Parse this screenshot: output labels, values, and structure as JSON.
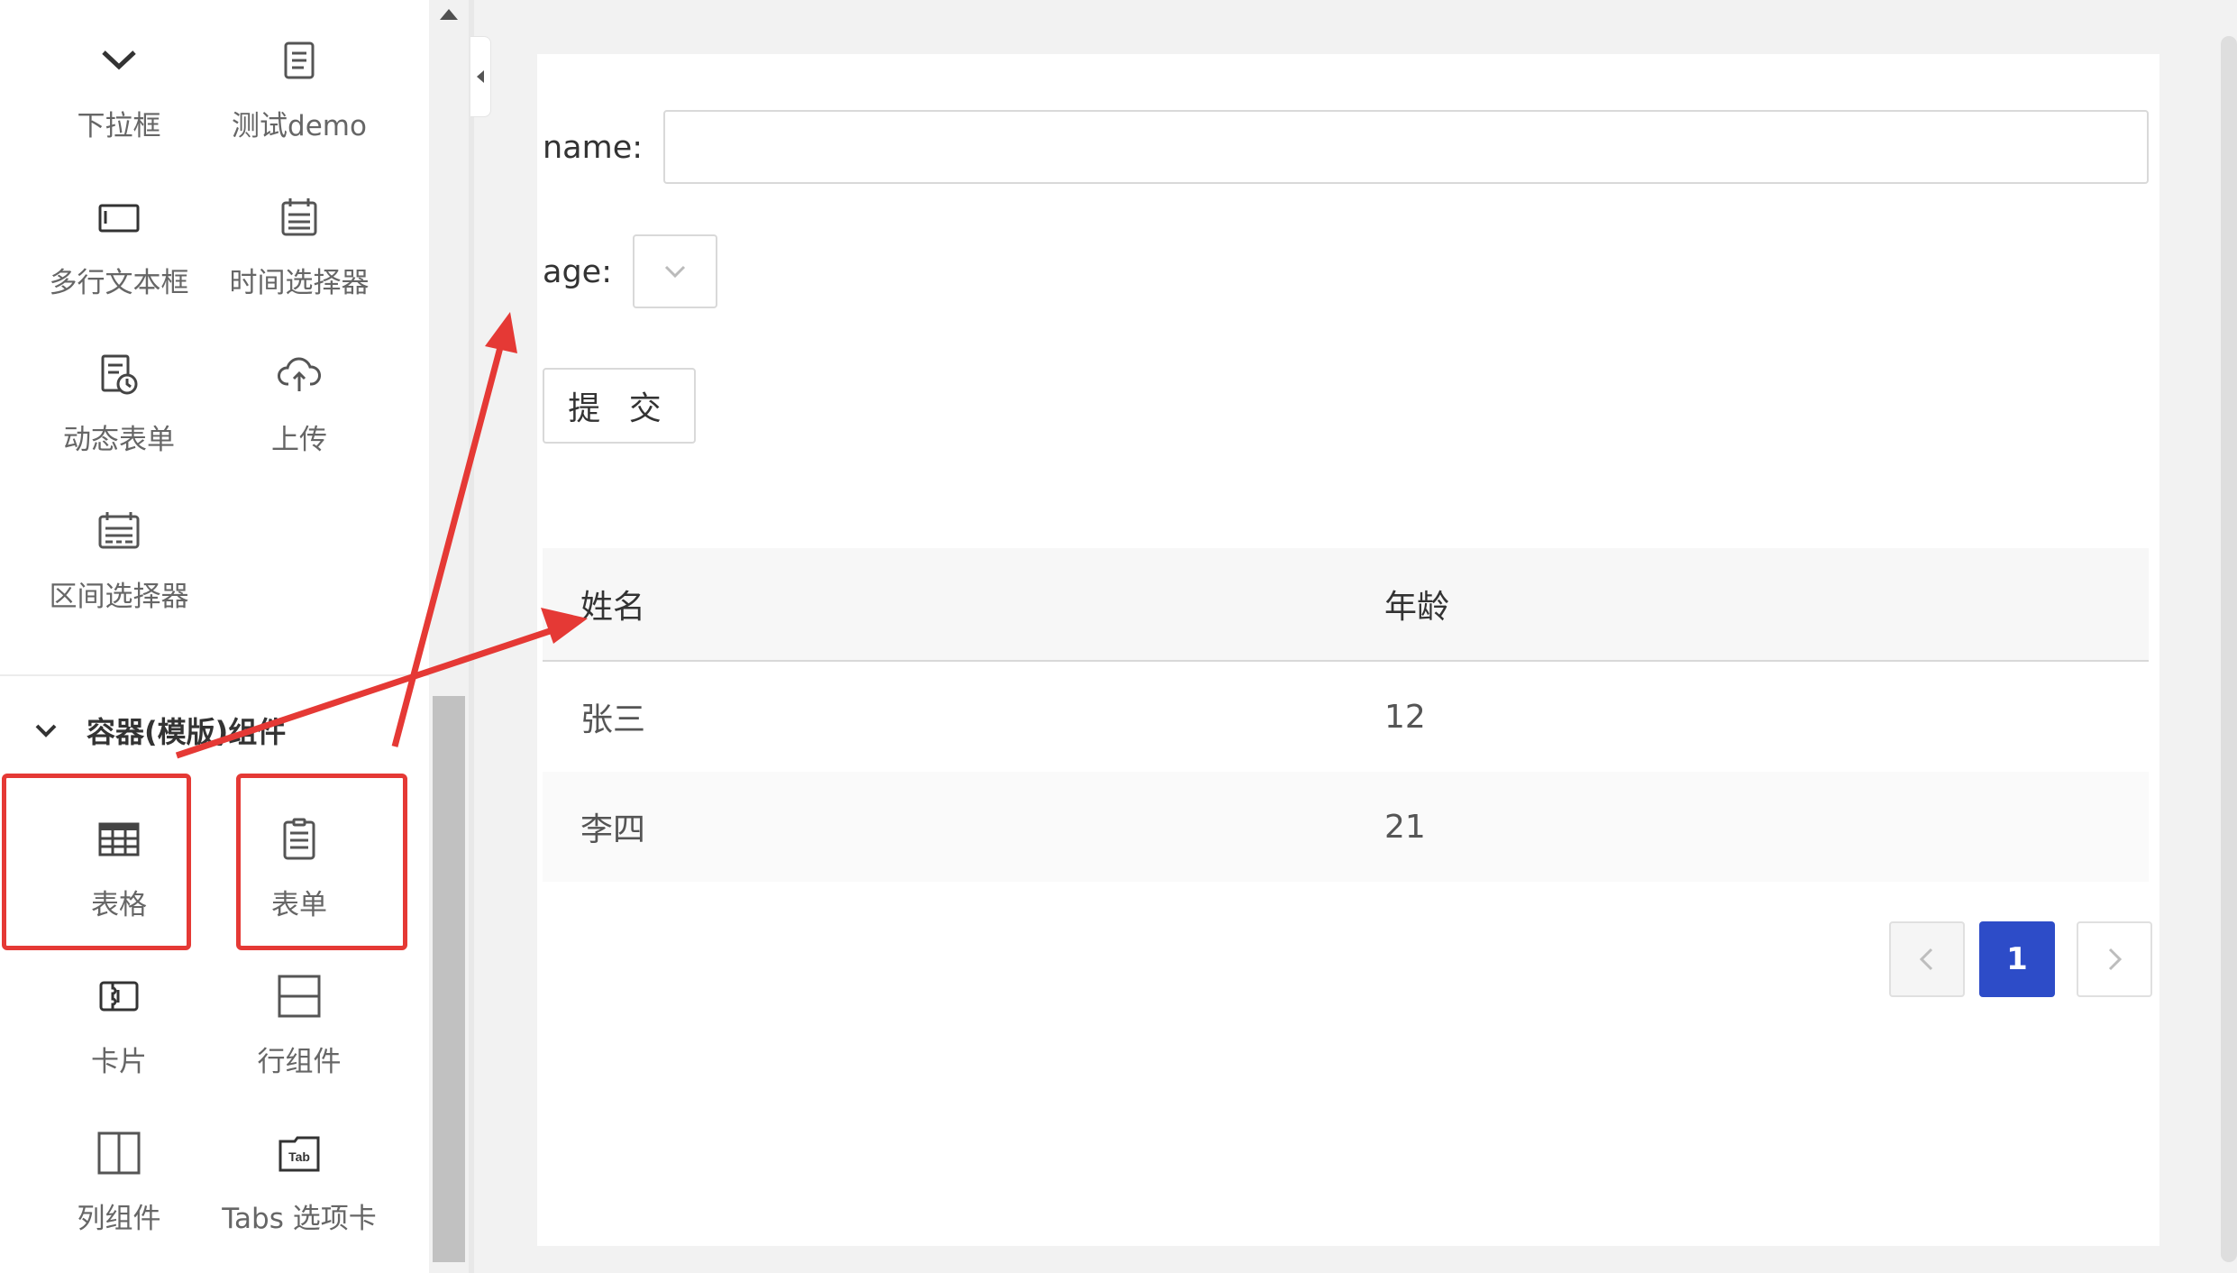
{
  "sidebar": {
    "items": [
      {
        "label": "下拉框",
        "icon": "chevron-down-icon"
      },
      {
        "label": "测试demo",
        "icon": "document-icon"
      },
      {
        "label": "多行文本框",
        "icon": "textarea-icon"
      },
      {
        "label": "时间选择器",
        "icon": "calendar-icon"
      },
      {
        "label": "动态表单",
        "icon": "dynamic-form-icon"
      },
      {
        "label": "上传",
        "icon": "cloud-upload-icon"
      },
      {
        "label": "区间选择器",
        "icon": "range-calendar-icon"
      }
    ],
    "group": {
      "title": "容器(模版)组件",
      "items": [
        {
          "label": "表格",
          "icon": "table-icon"
        },
        {
          "label": "表单",
          "icon": "form-icon"
        },
        {
          "label": "卡片",
          "icon": "card-icon"
        },
        {
          "label": "行组件",
          "icon": "row-icon"
        },
        {
          "label": "列组件",
          "icon": "column-icon"
        },
        {
          "label": "Tabs 选项卡",
          "icon": "tabs-icon"
        }
      ]
    }
  },
  "form": {
    "name_label": "name:",
    "name_value": "",
    "age_label": "age:",
    "age_value": "",
    "submit_label": "提 交"
  },
  "table": {
    "columns": [
      "姓名",
      "年龄"
    ],
    "rows": [
      [
        "张三",
        "12"
      ],
      [
        "李四",
        "21"
      ]
    ]
  },
  "pagination": {
    "current_page": "1"
  },
  "colors": {
    "highlight": "#e53935",
    "accent": "#2d4cc8"
  }
}
